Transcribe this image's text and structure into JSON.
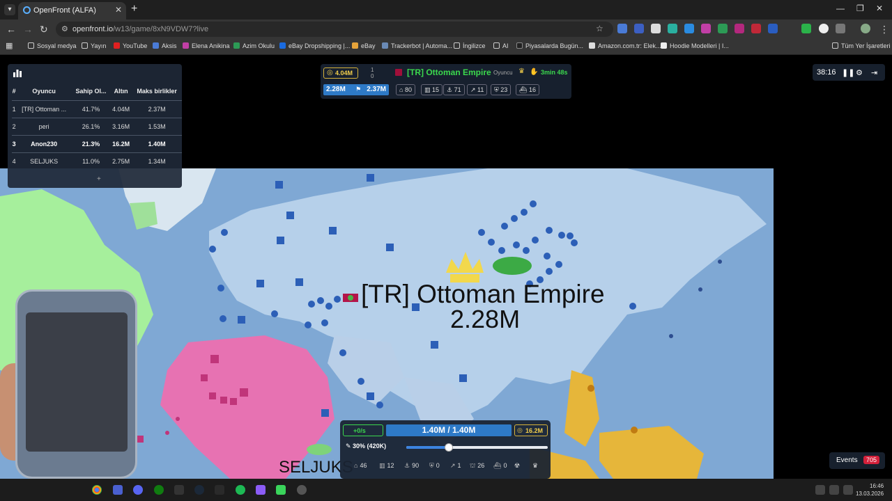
{
  "browser": {
    "tab_title": "OpenFront (ALFA)",
    "url_host": "openfront.io",
    "url_path": "/w13/game/8xN9VDW7?live",
    "bookmarks": [
      "Sosyal medya",
      "Yayın",
      "YouTube",
      "Aksis",
      "Elena Anikina",
      "Azim Okulu",
      "eBay Dropshipping |...",
      "eBay",
      "Trackerbot | Automa...",
      "İngilizce",
      "AI",
      "Piyasalarda Bugün...",
      "Amazon.com.tr: Elek...",
      "Hoodie Modelleri | I...",
      "Tüm Yer İşaretleri"
    ]
  },
  "leaderboard": {
    "headers": [
      "#",
      "Oyuncu",
      "Sahip Ol...",
      "Altın",
      "Maks birlikler"
    ],
    "rows": [
      {
        "rank": "1",
        "name": "[TR] Ottoman ...",
        "owned": "41.7%",
        "gold": "4.04M",
        "max": "2.37M"
      },
      {
        "rank": "2",
        "name": "peri",
        "owned": "26.1%",
        "gold": "3.16M",
        "max": "1.53M"
      },
      {
        "rank": "3",
        "name": "Anon230",
        "owned": "21.3%",
        "gold": "16.2M",
        "max": "1.40M"
      },
      {
        "rank": "4",
        "name": "SELJUKS",
        "owned": "11.0%",
        "gold": "2.75M",
        "max": "1.34M"
      }
    ],
    "expand": "+"
  },
  "player_info": {
    "gold": "4.04M",
    "rank_top": "1",
    "rank_bottom": "0",
    "name": "[TR] Ottoman Empire",
    "type": "Oyuncu",
    "time_left": "3min 48s",
    "troops": "2.28M",
    "max_troops": "2.37M",
    "stats": [
      "80",
      "15",
      "71",
      "11",
      "23",
      "16"
    ]
  },
  "game_controls": {
    "timer": "38:16"
  },
  "map": {
    "hover_name": "[TR] Ottoman Empire",
    "hover_troops": "2.28M",
    "label_seljuks": "SELJUKS"
  },
  "control_bar": {
    "rate": "+0/s",
    "troops": "1.40M / 1.40M",
    "gold": "16.2M",
    "attack_ratio": "30% (420K)",
    "attack_ratio_value": 0.3,
    "buildings": [
      "46",
      "12",
      "90",
      "0",
      "1",
      "26",
      "0"
    ]
  },
  "events": {
    "label": "Events",
    "count": "705"
  },
  "taskbar": {
    "time": "16:46",
    "date": "13.03.2026"
  }
}
